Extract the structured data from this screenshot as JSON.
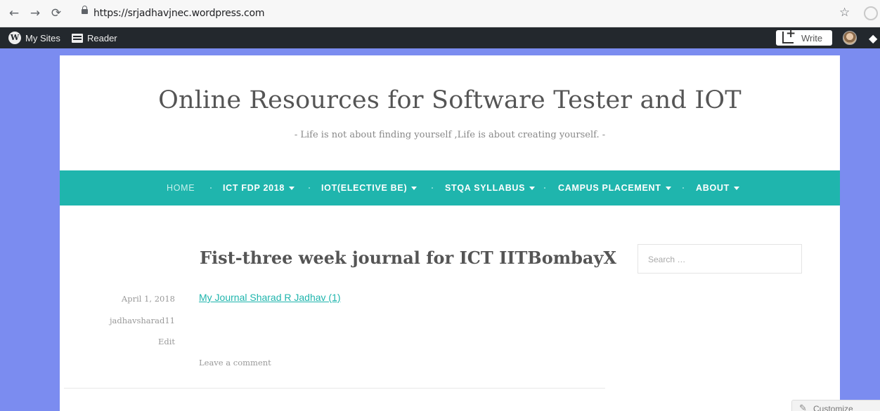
{
  "browser": {
    "url": "https://srjadhavjnec.wordpress.com"
  },
  "adminbar": {
    "my_sites": "My Sites",
    "reader": "Reader",
    "write": "Write"
  },
  "site": {
    "title": "Online Resources for Software Tester and IOT",
    "tagline": "- Life is not about finding yourself ,Life is about creating yourself. -"
  },
  "menu": {
    "items": [
      {
        "label": "HOME"
      },
      {
        "label": "ICT FDP 2018"
      },
      {
        "label": "IOT(ELECTIVE BE)"
      },
      {
        "label": "STQA SYLLABUS"
      },
      {
        "label": "CAMPUS PLACEMENT"
      },
      {
        "label": "ABOUT"
      }
    ]
  },
  "post": {
    "title": "Fist-three week journal for ICT IITBombayX",
    "date": "April 1, 2018",
    "author": "jadhavsharad11",
    "edit": "Edit",
    "link_text": "My Journal Sharad R Jadhav (1)",
    "comment": "Leave a comment"
  },
  "sidebar": {
    "search_placeholder": "Search …"
  },
  "customize": {
    "label": "Customize"
  }
}
